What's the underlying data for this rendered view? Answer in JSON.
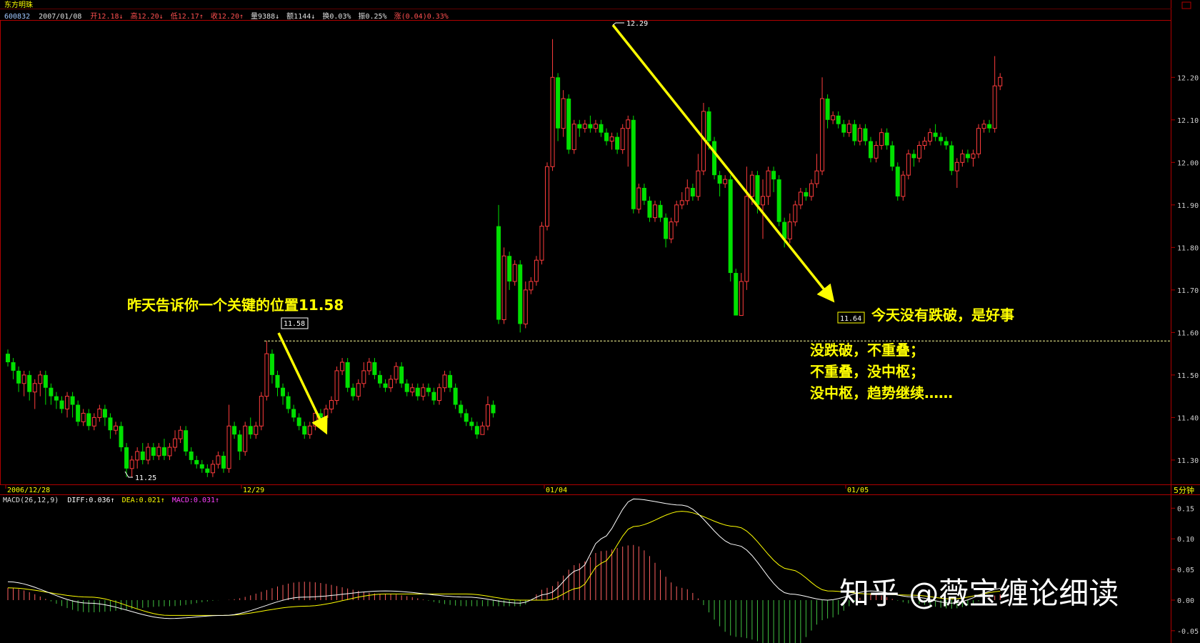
{
  "header": {
    "stock_name": "东方明珠",
    "code": "600832",
    "date": "2007/01/08",
    "open_label": "开",
    "open": "12.18↓",
    "high_label": "高",
    "high": "12.20↓",
    "low_label": "低",
    "low": "12.17↑",
    "close_label": "收",
    "close": "12.20↑",
    "volume_label": "量",
    "volume": "9388↓",
    "amount_label": "额",
    "amount": "1144↓",
    "turnover_label": "换",
    "turnover": "0.03%",
    "amplitude_label": "振",
    "amplitude": "0.25%",
    "change_label": "涨",
    "change": "(0.04)",
    "change_pct": "0.33%"
  },
  "macd_header": {
    "name": "MACD(26,12,9)",
    "diff": "DIFF:0.036↑",
    "dea": "DEA:0.021↑",
    "macd": "MACD:0.031↑"
  },
  "period_label": "5分钟",
  "watermark": "知乎 @薇宝缠论细读",
  "annotations": {
    "left_text": "昨天告诉你一个关键的位置11.58",
    "right_text": "今天没有跌破，是好事",
    "logic_lines": [
      "没跌破，不重叠；",
      "不重叠，没中枢；",
      "没中枢，趋势继续……"
    ],
    "label_1158": "11.58",
    "label_1164": "11.64",
    "label_1229": "12.29",
    "label_1125": "11.25"
  },
  "colors": {
    "up": "#ff3c3c",
    "down": "#00e000",
    "axis": "#b00000",
    "yellow": "#ffff00",
    "text_red": "#ff5050",
    "diff": "#ffffff",
    "dea": "#ffff00"
  },
  "chart_data": {
    "type": "candlestick",
    "price_axis": {
      "ylim": [
        11.2427,
        12.3349
      ],
      "ticks": [
        11.3,
        11.4,
        11.5,
        11.6,
        11.7,
        11.8,
        11.9,
        12.0,
        12.1,
        12.2
      ]
    },
    "x_ticks": [
      "2006/12/28",
      "12/29",
      "01/04",
      "01/05"
    ],
    "reference_level": 11.58,
    "marked_points": [
      {
        "label": "11.25",
        "value": 11.25,
        "type": "low"
      },
      {
        "label": "11.58",
        "value": 11.58,
        "type": "high"
      },
      {
        "label": "12.29",
        "value": 12.29,
        "type": "high"
      },
      {
        "label": "11.64",
        "value": 11.64,
        "type": "low"
      }
    ],
    "trend_lines": [
      {
        "from": 11.58,
        "to": 11.35
      },
      {
        "from": 12.29,
        "to": 11.64
      }
    ],
    "candles": [
      [
        11.55,
        11.53,
        11.56,
        11.52
      ],
      [
        11.53,
        11.51,
        11.54,
        11.49
      ],
      [
        11.51,
        11.48,
        11.52,
        11.46
      ],
      [
        11.48,
        11.5,
        11.51,
        11.45
      ],
      [
        11.5,
        11.46,
        11.51,
        11.44
      ],
      [
        11.46,
        11.48,
        11.49,
        11.42
      ],
      [
        11.48,
        11.5,
        11.51,
        11.45
      ],
      [
        11.5,
        11.47,
        11.51,
        11.43
      ],
      [
        11.47,
        11.45,
        11.48,
        11.43
      ],
      [
        11.45,
        11.44,
        11.46,
        11.42
      ],
      [
        11.44,
        11.42,
        11.45,
        11.41
      ],
      [
        11.42,
        11.45,
        11.46,
        11.4
      ],
      [
        11.45,
        11.43,
        11.46,
        11.4
      ],
      [
        11.43,
        11.39,
        11.44,
        11.38
      ],
      [
        11.39,
        11.41,
        11.42,
        11.38
      ],
      [
        11.41,
        11.38,
        11.42,
        11.37
      ],
      [
        11.38,
        11.4,
        11.41,
        11.37
      ],
      [
        11.4,
        11.42,
        11.43,
        11.39
      ],
      [
        11.42,
        11.4,
        11.43,
        11.38
      ],
      [
        11.4,
        11.37,
        11.41,
        11.35
      ],
      [
        11.37,
        11.38,
        11.39,
        11.36
      ],
      [
        11.38,
        11.33,
        11.39,
        11.32
      ],
      [
        11.33,
        11.28,
        11.34,
        11.26
      ],
      [
        11.28,
        11.3,
        11.31,
        11.26
      ],
      [
        11.3,
        11.32,
        11.33,
        11.28
      ],
      [
        11.32,
        11.3,
        11.34,
        11.29
      ],
      [
        11.3,
        11.33,
        11.34,
        11.29
      ],
      [
        11.33,
        11.31,
        11.34,
        11.3
      ],
      [
        11.31,
        11.33,
        11.34,
        11.3
      ],
      [
        11.33,
        11.31,
        11.35,
        11.3
      ],
      [
        11.31,
        11.33,
        11.34,
        11.3
      ],
      [
        11.33,
        11.35,
        11.37,
        11.32
      ],
      [
        11.35,
        11.37,
        11.38,
        11.34
      ],
      [
        11.37,
        11.32,
        11.38,
        11.31
      ],
      [
        11.32,
        11.3,
        11.33,
        11.29
      ],
      [
        11.3,
        11.29,
        11.31,
        11.28
      ],
      [
        11.29,
        11.28,
        11.3,
        11.27
      ],
      [
        11.28,
        11.27,
        11.29,
        11.26
      ],
      [
        11.27,
        11.29,
        11.3,
        11.26
      ],
      [
        11.29,
        11.31,
        11.32,
        11.28
      ],
      [
        11.31,
        11.28,
        11.32,
        11.27
      ],
      [
        11.28,
        11.38,
        11.43,
        11.27
      ],
      [
        11.38,
        11.36,
        11.39,
        11.35
      ],
      [
        11.36,
        11.32,
        11.37,
        11.3
      ],
      [
        11.32,
        11.38,
        11.39,
        11.31
      ],
      [
        11.38,
        11.36,
        11.4,
        11.35
      ],
      [
        11.36,
        11.38,
        11.39,
        11.35
      ],
      [
        11.38,
        11.45,
        11.46,
        11.37
      ],
      [
        11.45,
        11.55,
        11.58,
        11.44
      ],
      [
        11.55,
        11.5,
        11.56,
        11.48
      ],
      [
        11.5,
        11.47,
        11.51,
        11.45
      ],
      [
        11.47,
        11.45,
        11.48,
        11.43
      ],
      [
        11.45,
        11.42,
        11.46,
        11.41
      ],
      [
        11.42,
        11.4,
        11.43,
        11.39
      ],
      [
        11.4,
        11.38,
        11.41,
        11.37
      ],
      [
        11.38,
        11.36,
        11.39,
        11.35
      ],
      [
        11.36,
        11.38,
        11.39,
        11.35
      ],
      [
        11.38,
        11.41,
        11.42,
        11.37
      ],
      [
        11.41,
        11.4,
        11.42,
        11.38
      ],
      [
        11.4,
        11.42,
        11.43,
        11.39
      ],
      [
        11.42,
        11.44,
        11.45,
        11.41
      ],
      [
        11.44,
        11.51,
        11.52,
        11.43
      ],
      [
        11.51,
        11.53,
        11.54,
        11.5
      ],
      [
        11.53,
        11.47,
        11.54,
        11.46
      ],
      [
        11.47,
        11.45,
        11.48,
        11.44
      ],
      [
        11.45,
        11.48,
        11.49,
        11.44
      ],
      [
        11.48,
        11.51,
        11.53,
        11.47
      ],
      [
        11.51,
        11.53,
        11.54,
        11.5
      ],
      [
        11.53,
        11.5,
        11.54,
        11.49
      ],
      [
        11.5,
        11.48,
        11.51,
        11.47
      ],
      [
        11.48,
        11.47,
        11.49,
        11.46
      ],
      [
        11.47,
        11.49,
        11.5,
        11.46
      ],
      [
        11.49,
        11.52,
        11.53,
        11.48
      ],
      [
        11.52,
        11.48,
        11.53,
        11.47
      ],
      [
        11.48,
        11.46,
        11.49,
        11.45
      ],
      [
        11.46,
        11.47,
        11.48,
        11.45
      ],
      [
        11.47,
        11.45,
        11.48,
        11.44
      ],
      [
        11.45,
        11.47,
        11.48,
        11.44
      ],
      [
        11.47,
        11.46,
        11.48,
        11.45
      ],
      [
        11.46,
        11.44,
        11.47,
        11.43
      ],
      [
        11.44,
        11.47,
        11.48,
        11.43
      ],
      [
        11.47,
        11.5,
        11.51,
        11.46
      ],
      [
        11.5,
        11.47,
        11.51,
        11.46
      ],
      [
        11.47,
        11.43,
        11.48,
        11.42
      ],
      [
        11.43,
        11.41,
        11.44,
        11.4
      ],
      [
        11.41,
        11.39,
        11.42,
        11.38
      ],
      [
        11.39,
        11.38,
        11.4,
        11.37
      ],
      [
        11.38,
        11.36,
        11.39,
        11.35
      ],
      [
        11.36,
        11.38,
        11.39,
        11.36
      ],
      [
        11.38,
        11.43,
        11.45,
        11.37
      ],
      [
        11.43,
        11.41,
        11.44,
        11.4
      ],
      [
        11.85,
        11.63,
        11.9,
        11.62
      ],
      [
        11.63,
        11.78,
        11.8,
        11.62
      ],
      [
        11.78,
        11.72,
        11.79,
        11.7
      ],
      [
        11.72,
        11.76,
        11.77,
        11.71
      ],
      [
        11.76,
        11.62,
        11.77,
        11.6
      ],
      [
        11.62,
        11.7,
        11.72,
        11.61
      ],
      [
        11.7,
        11.72,
        11.73,
        11.69
      ],
      [
        11.72,
        11.77,
        11.78,
        11.71
      ],
      [
        11.77,
        11.85,
        11.86,
        11.76
      ],
      [
        11.85,
        11.99,
        12.0,
        11.84
      ],
      [
        11.99,
        12.2,
        12.29,
        11.98
      ],
      [
        12.2,
        12.08,
        12.21,
        12.05
      ],
      [
        12.08,
        12.15,
        12.17,
        12.06
      ],
      [
        12.15,
        12.03,
        12.16,
        12.02
      ],
      [
        12.03,
        12.09,
        12.1,
        12.02
      ],
      [
        12.09,
        12.08,
        12.1,
        12.06
      ],
      [
        12.08,
        12.09,
        12.1,
        12.07
      ],
      [
        12.09,
        12.08,
        12.11,
        12.07
      ],
      [
        12.08,
        12.09,
        12.1,
        12.07
      ],
      [
        12.09,
        12.07,
        12.1,
        12.06
      ],
      [
        12.07,
        12.05,
        12.08,
        12.04
      ],
      [
        12.05,
        12.06,
        12.07,
        12.03
      ],
      [
        12.06,
        12.03,
        12.07,
        12.02
      ],
      [
        12.03,
        12.08,
        12.09,
        12.02
      ],
      [
        12.08,
        12.1,
        12.11,
        11.99
      ],
      [
        12.1,
        11.89,
        12.11,
        11.88
      ],
      [
        11.89,
        11.94,
        11.95,
        11.88
      ],
      [
        11.94,
        11.91,
        11.95,
        11.9
      ],
      [
        11.91,
        11.87,
        11.92,
        11.86
      ],
      [
        11.87,
        11.9,
        11.91,
        11.86
      ],
      [
        11.9,
        11.87,
        11.91,
        11.86
      ],
      [
        11.87,
        11.82,
        11.88,
        11.8
      ],
      [
        11.82,
        11.86,
        11.87,
        11.81
      ],
      [
        11.86,
        11.9,
        11.91,
        11.85
      ],
      [
        11.9,
        11.91,
        11.93,
        11.89
      ],
      [
        11.91,
        11.94,
        11.96,
        11.9
      ],
      [
        11.94,
        11.92,
        11.95,
        11.91
      ],
      [
        11.92,
        11.98,
        12.02,
        11.91
      ],
      [
        11.98,
        12.12,
        12.14,
        11.97
      ],
      [
        12.12,
        12.05,
        12.13,
        12.03
      ],
      [
        12.05,
        11.97,
        12.06,
        11.96
      ],
      [
        11.97,
        11.95,
        11.98,
        11.92
      ],
      [
        11.95,
        11.96,
        11.97,
        11.94
      ],
      [
        11.96,
        11.74,
        11.97,
        11.72
      ],
      [
        11.74,
        11.64,
        11.75,
        11.64
      ],
      [
        11.64,
        11.72,
        11.74,
        11.66
      ],
      [
        11.72,
        11.92,
        11.99,
        11.7
      ],
      [
        11.92,
        11.97,
        11.98,
        11.9
      ],
      [
        11.97,
        11.9,
        11.98,
        11.88
      ],
      [
        11.9,
        11.92,
        11.96,
        11.82
      ],
      [
        11.92,
        11.98,
        11.99,
        11.9
      ],
      [
        11.98,
        11.96,
        11.99,
        11.93
      ],
      [
        11.96,
        11.86,
        11.97,
        11.85
      ],
      [
        11.86,
        11.82,
        11.87,
        11.8
      ],
      [
        11.82,
        11.86,
        11.88,
        11.81
      ],
      [
        11.86,
        11.9,
        11.91,
        11.85
      ],
      [
        11.9,
        11.93,
        11.94,
        11.89
      ],
      [
        11.93,
        11.92,
        11.94,
        11.91
      ],
      [
        11.92,
        11.95,
        11.96,
        11.91
      ],
      [
        11.95,
        11.98,
        12.02,
        11.94
      ],
      [
        11.98,
        12.15,
        12.2,
        11.97
      ],
      [
        12.15,
        12.1,
        12.16,
        12.08
      ],
      [
        12.1,
        12.11,
        12.12,
        12.09
      ],
      [
        12.11,
        12.09,
        12.12,
        12.08
      ],
      [
        12.09,
        12.07,
        12.1,
        12.06
      ],
      [
        12.07,
        12.09,
        12.1,
        12.06
      ],
      [
        12.09,
        12.05,
        12.1,
        12.04
      ],
      [
        12.05,
        12.08,
        12.09,
        12.04
      ],
      [
        12.08,
        12.05,
        12.09,
        12.04
      ],
      [
        12.05,
        12.01,
        12.06,
        12.0
      ],
      [
        12.01,
        12.04,
        12.05,
        12.0
      ],
      [
        12.04,
        12.07,
        12.08,
        12.03
      ],
      [
        12.07,
        12.04,
        12.08,
        12.03
      ],
      [
        12.04,
        11.99,
        12.05,
        11.98
      ],
      [
        11.99,
        11.92,
        12.0,
        11.91
      ],
      [
        11.92,
        11.97,
        11.98,
        11.91
      ],
      [
        11.97,
        12.02,
        12.03,
        11.96
      ],
      [
        12.02,
        12.01,
        12.03,
        11.99
      ],
      [
        12.01,
        12.04,
        12.05,
        12.0
      ],
      [
        12.04,
        12.05,
        12.06,
        12.03
      ],
      [
        12.05,
        12.07,
        12.08,
        12.04
      ],
      [
        12.07,
        12.06,
        12.09,
        12.05
      ],
      [
        12.06,
        12.05,
        12.07,
        12.04
      ],
      [
        12.05,
        12.04,
        12.06,
        12.03
      ],
      [
        12.04,
        11.98,
        12.05,
        11.97
      ],
      [
        11.98,
        12.0,
        12.01,
        11.94
      ],
      [
        12.0,
        12.02,
        12.03,
        11.99
      ],
      [
        12.02,
        12.01,
        12.03,
        12.0
      ],
      [
        12.01,
        12.02,
        12.03,
        11.99
      ],
      [
        12.02,
        12.08,
        12.09,
        12.01
      ],
      [
        12.08,
        12.09,
        12.1,
        12.07
      ],
      [
        12.09,
        12.08,
        12.1,
        12.07
      ],
      [
        12.08,
        12.18,
        12.25,
        12.07
      ],
      [
        12.18,
        12.2,
        12.21,
        12.17
      ]
    ],
    "macd": {
      "ylim": [
        -0.07,
        0.1725
      ],
      "ticks": [
        -0.05,
        0.0,
        0.05,
        0.1,
        0.15
      ],
      "diff_anchors": [
        [
          0,
          0.03
        ],
        [
          15,
          -0.005
        ],
        [
          30,
          -0.03
        ],
        [
          40,
          -0.025
        ],
        [
          55,
          0.005
        ],
        [
          70,
          0.015
        ],
        [
          85,
          0.005
        ],
        [
          95,
          -0.005
        ],
        [
          100,
          0.01
        ],
        [
          106,
          0.05
        ],
        [
          110,
          0.1
        ],
        [
          116,
          0.165
        ],
        [
          125,
          0.155
        ],
        [
          135,
          0.09
        ],
        [
          145,
          0.01
        ],
        [
          152,
          0.0
        ],
        [
          160,
          0.015
        ],
        [
          168,
          0.005
        ],
        [
          175,
          -0.005
        ],
        [
          185,
          0.02
        ],
        [
          195,
          0.02
        ],
        [
          205,
          0.015
        ],
        [
          215,
          0.01
        ],
        [
          230,
          0.036
        ]
      ],
      "dea_anchors": [
        [
          0,
          0.02
        ],
        [
          15,
          0.005
        ],
        [
          30,
          -0.025
        ],
        [
          40,
          -0.025
        ],
        [
          55,
          -0.01
        ],
        [
          70,
          0.01
        ],
        [
          85,
          0.01
        ],
        [
          95,
          0.0
        ],
        [
          100,
          0.0
        ],
        [
          106,
          0.02
        ],
        [
          110,
          0.06
        ],
        [
          116,
          0.12
        ],
        [
          125,
          0.145
        ],
        [
          135,
          0.12
        ],
        [
          145,
          0.05
        ],
        [
          152,
          0.015
        ],
        [
          160,
          0.01
        ],
        [
          168,
          0.008
        ],
        [
          175,
          0.002
        ],
        [
          185,
          0.015
        ],
        [
          195,
          0.02
        ],
        [
          205,
          0.018
        ],
        [
          215,
          0.012
        ],
        [
          230,
          0.021
        ]
      ]
    }
  }
}
